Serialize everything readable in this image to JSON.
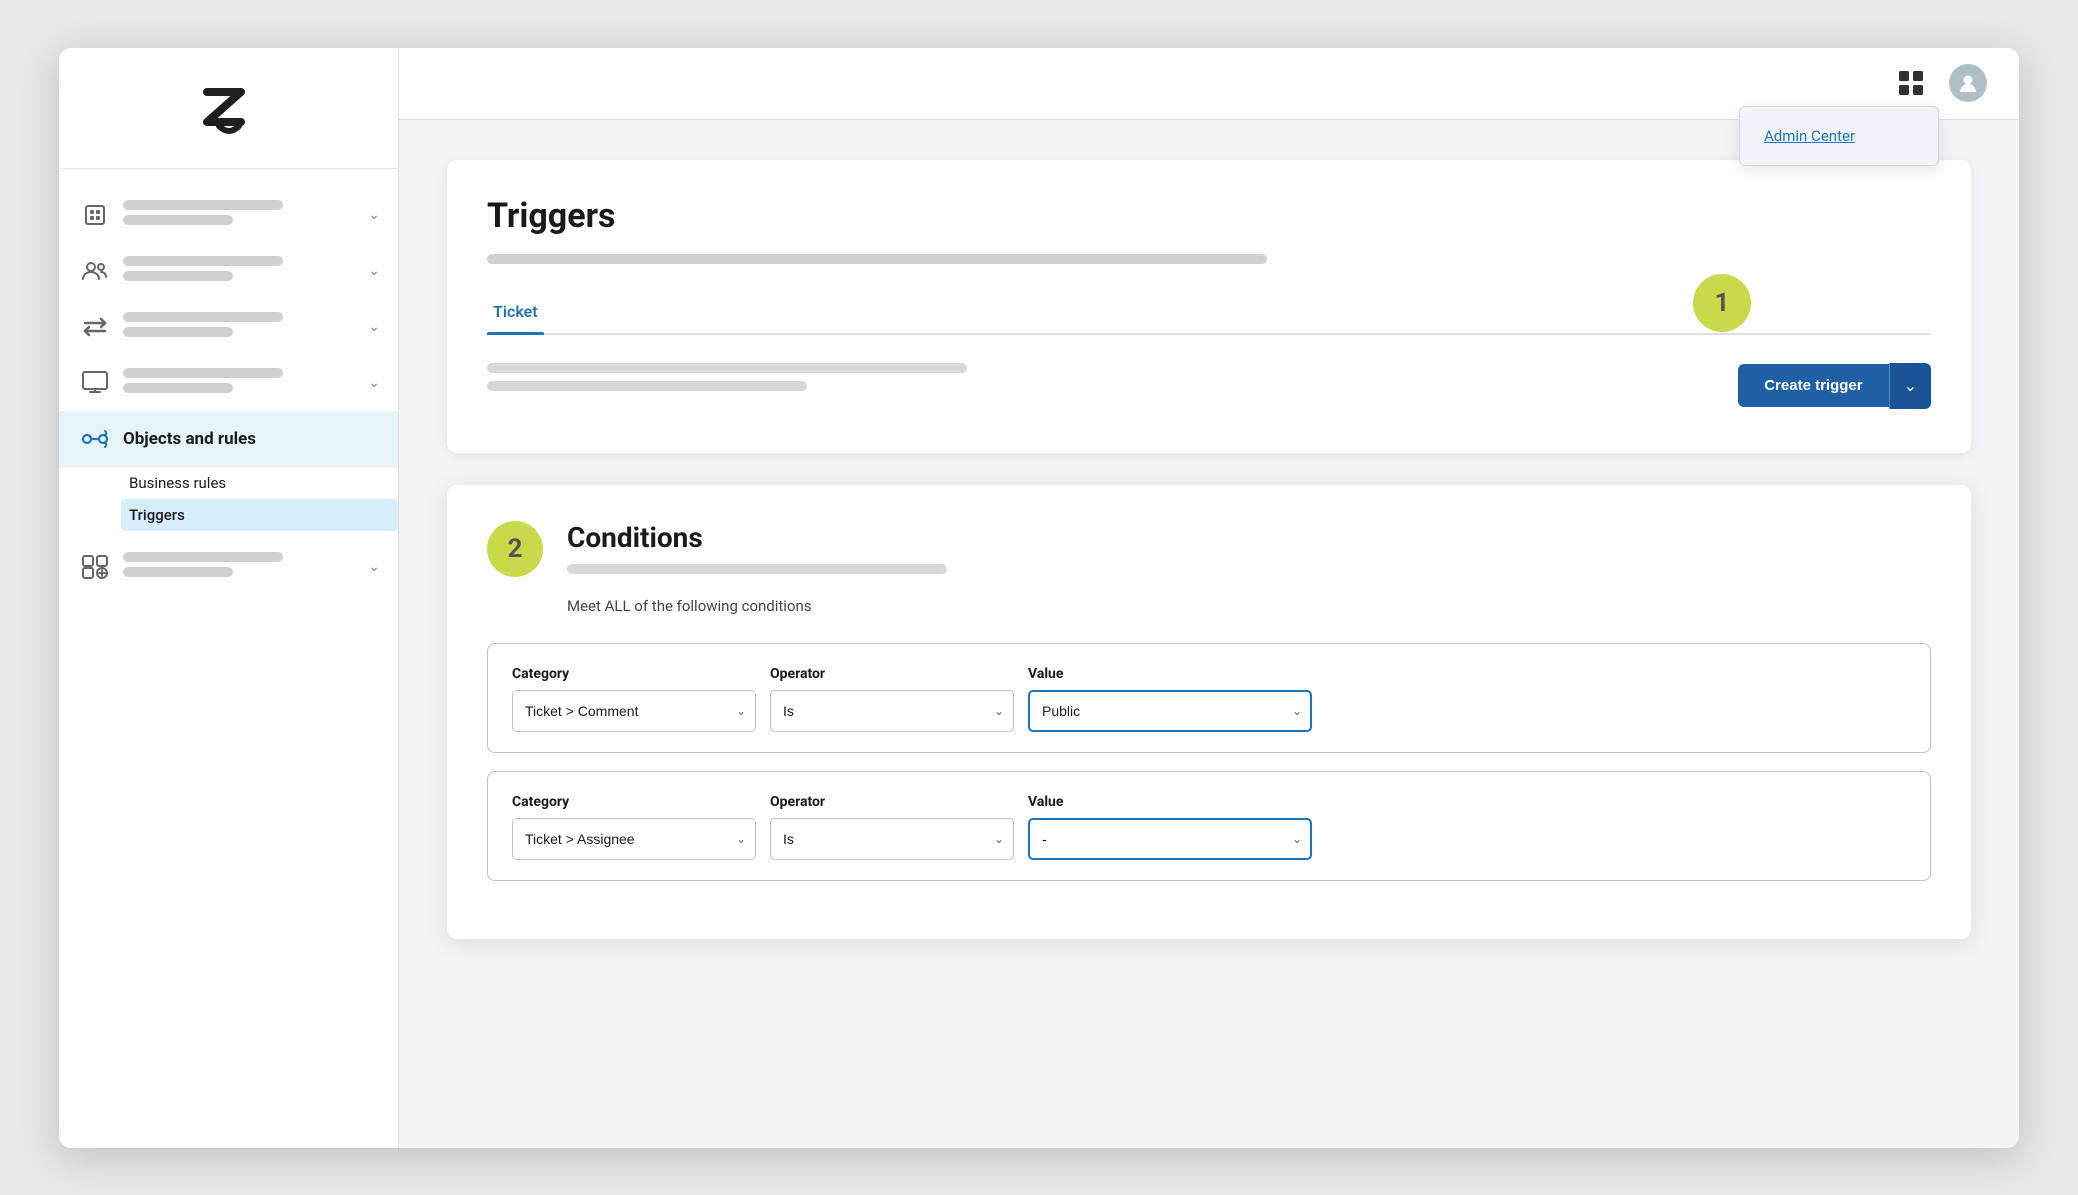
{
  "sidebar": {
    "logo_alt": "Zendesk logo",
    "items": [
      {
        "id": "workspace",
        "icon": "building-icon",
        "active": false,
        "bars": [
          160,
          110
        ]
      },
      {
        "id": "people",
        "icon": "people-icon",
        "active": false,
        "bars": [
          160,
          110
        ]
      },
      {
        "id": "channels",
        "icon": "arrows-icon",
        "active": false,
        "bars": [
          160,
          110
        ]
      },
      {
        "id": "monitor",
        "icon": "monitor-icon",
        "active": false,
        "bars": [
          160,
          110
        ]
      },
      {
        "id": "objects-rules",
        "icon": "objects-rules-icon",
        "active": true,
        "label": "Objects and rules"
      },
      {
        "id": "apps",
        "icon": "apps-icon",
        "active": false,
        "bars": [
          160,
          110
        ]
      }
    ],
    "sub_items": [
      {
        "id": "business-rules",
        "label": "Business rules",
        "active": false
      },
      {
        "id": "triggers",
        "label": "Triggers",
        "active": true
      }
    ]
  },
  "topbar": {
    "grid_icon": "grid-icon",
    "avatar_icon": "user-icon",
    "dropdown": {
      "visible": true,
      "items": [
        {
          "id": "admin-center",
          "label": "Admin Center"
        }
      ]
    }
  },
  "page": {
    "title": "Triggers",
    "tabs": [
      {
        "id": "ticket",
        "label": "Ticket",
        "active": true
      }
    ],
    "step1_badge": "1",
    "create_trigger_label": "Create trigger",
    "create_trigger_dropdown_label": "▾"
  },
  "conditions": {
    "step2_badge": "2",
    "title": "Conditions",
    "meet_all_label": "Meet ALL of the following conditions",
    "rows": [
      {
        "category_label": "Category",
        "category_value": "Ticket > Comment",
        "operator_label": "Operator",
        "operator_value": "Is",
        "value_label": "Value",
        "value_value": "Public",
        "value_highlighted": true
      },
      {
        "category_label": "Category",
        "category_value": "Ticket > Assignee",
        "operator_label": "Operator",
        "operator_value": "Is",
        "value_label": "Value",
        "value_value": "-",
        "value_highlighted": true
      }
    ]
  },
  "ticket_comment_text": "Ticket Comment",
  "objects_and_rules_text": "Objects and rules"
}
